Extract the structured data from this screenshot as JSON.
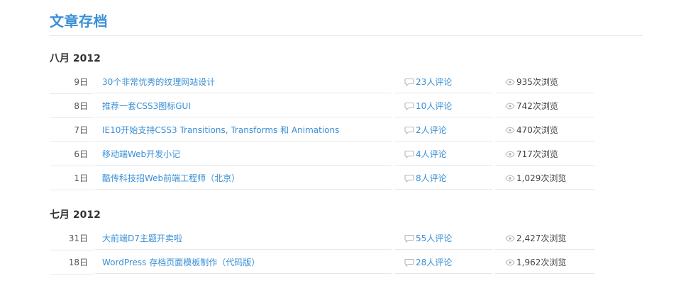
{
  "page": {
    "title": "文章存档"
  },
  "archive": [
    {
      "month": "八月 2012",
      "posts": [
        {
          "day": "9日",
          "title": "30个非常优秀的纹理网站设计",
          "comments": "23人评论",
          "views": "935次浏览"
        },
        {
          "day": "8日",
          "title": "推荐一套CSS3图标GUI",
          "comments": "10人评论",
          "views": "742次浏览"
        },
        {
          "day": "7日",
          "title": "IE10开始支持CSS3 Transitions, Transforms 和 Animations",
          "comments": "2人评论",
          "views": "470次浏览"
        },
        {
          "day": "6日",
          "title": "移动端Web开发小记",
          "comments": "4人评论",
          "views": "717次浏览"
        },
        {
          "day": "1日",
          "title": "酷传科技招Web前端工程师（北京）",
          "comments": "8人评论",
          "views": "1,029次浏览"
        }
      ]
    },
    {
      "month": "七月 2012",
      "posts": [
        {
          "day": "31日",
          "title": "大前端D7主题开卖啦",
          "comments": "55人评论",
          "views": "2,427次浏览"
        },
        {
          "day": "18日",
          "title": "WordPress 存档页面模板制作（代码版）",
          "comments": "28人评论",
          "views": "1,962次浏览"
        }
      ]
    }
  ],
  "icons": {
    "comment": "speech-bubble-icon",
    "views": "eye-icon"
  },
  "colors": {
    "accent": "#3a8fd6",
    "text": "#333333",
    "divider": "#e8e8e8"
  }
}
